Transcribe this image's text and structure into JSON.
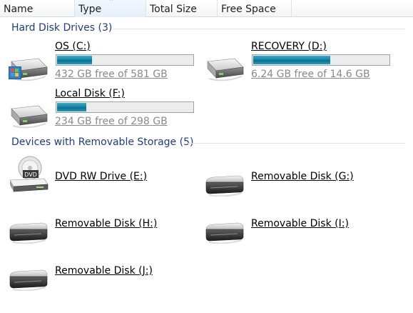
{
  "columns": [
    {
      "label": "Name"
    },
    {
      "label": "Type",
      "sorted": true
    },
    {
      "label": "Total Size"
    },
    {
      "label": "Free Space"
    }
  ],
  "groups": {
    "hard_disks": {
      "title": "Hard Disk Drives (3)",
      "drives": [
        {
          "name": "OS (C:)",
          "free_text": "432 GB free of 581 GB",
          "used_fraction": 0.26,
          "icon": "windows-hard-drive-icon"
        },
        {
          "name": "RECOVERY (D:)",
          "free_text": "6.24 GB free of 14.6 GB",
          "used_fraction": 0.57,
          "icon": "hard-drive-icon"
        },
        {
          "name": "Local Disk (F:)",
          "free_text": "234 GB free of 298 GB",
          "used_fraction": 0.215,
          "icon": "hard-drive-icon"
        }
      ]
    },
    "removable": {
      "title": "Devices with Removable Storage (5)",
      "devices": [
        {
          "name": "DVD RW Drive (E:)",
          "icon": "dvd-drive-icon"
        },
        {
          "name": "Removable Disk (G:)",
          "icon": "removable-disk-icon"
        },
        {
          "name": "Removable Disk (H:)",
          "icon": "removable-disk-icon"
        },
        {
          "name": "Removable Disk (I:)",
          "icon": "removable-disk-icon"
        },
        {
          "name": "Removable Disk (J:)",
          "icon": "removable-disk-icon"
        }
      ]
    }
  },
  "colors": {
    "group_title": "#1e3a8a",
    "bar_fill": "#1587a8"
  }
}
